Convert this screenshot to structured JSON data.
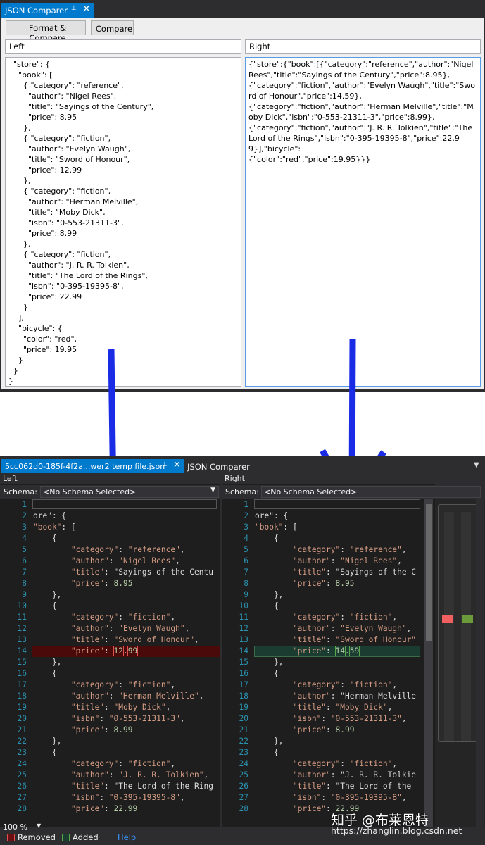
{
  "top_window": {
    "tab_title": "JSON Comparer",
    "tab_pin": "⊥",
    "tab_close": "✕",
    "buttons": {
      "format_compare": "Format & Compare",
      "compare": "Compare"
    },
    "left_header": "Left",
    "right_header": "Right",
    "left_text": "  \"store\": {\n    \"book\": [\n      { \"category\": \"reference\",\n        \"author\": \"Nigel Rees\",\n        \"title\": \"Sayings of the Century\",\n        \"price\": 8.95\n      },\n      { \"category\": \"fiction\",\n        \"author\": \"Evelyn Waugh\",\n        \"title\": \"Sword of Honour\",\n        \"price\": 12.99\n      },\n      { \"category\": \"fiction\",\n        \"author\": \"Herman Melville\",\n        \"title\": \"Moby Dick\",\n        \"isbn\": \"0-553-21311-3\",\n        \"price\": 8.99\n      },\n      { \"category\": \"fiction\",\n        \"author\": \"J. R. R. Tolkien\",\n        \"title\": \"The Lord of the Rings\",\n        \"isbn\": \"0-395-19395-8\",\n        \"price\": 22.99\n      }\n    ],\n    \"bicycle\": {\n      \"color\": \"red\",\n      \"price\": 19.95\n    }\n  }\n}",
    "right_text": "{\"store\":{\"book\":[{\"category\":\"reference\",\"author\":\"Nigel Rees\",\"title\":\"Sayings of the Century\",\"price\":8.95},\n{\"category\":\"fiction\",\"author\":\"Evelyn Waugh\",\"title\":\"Sword of Honour\",\"price\":14.59},\n{\"category\":\"fiction\",\"author\":\"Herman Melville\",\"title\":\"Moby Dick\",\"isbn\":\"0-553-21311-3\",\"price\":8.99},\n{\"category\":\"fiction\",\"author\":\"J. R. R. Tolkien\",\"title\":\"The Lord of the Rings\",\"isbn\":\"0-395-19395-8\",\"price\":22.99}],\"bicycle\":\n{\"color\":\"red\",\"price\":19.95}}}"
  },
  "bottom_window": {
    "tab_active": "5cc062d0-185f-4f2a...wer2 temp file.json",
    "tab_pin": "⊥",
    "tab_close": "✕",
    "tab_other": "JSON Comparer",
    "left_header": "Left",
    "right_header": "Right",
    "schema_label": "Schema:",
    "schema_value": "<No Schema Selected>",
    "left_lines": [
      {
        "n": "1",
        "t": ""
      },
      {
        "n": "2",
        "t": "ore\": {"
      },
      {
        "n": "3",
        "t": "\"book\": ["
      },
      {
        "n": "4",
        "t": "    {"
      },
      {
        "n": "5",
        "t": "        \"category\": \"reference\","
      },
      {
        "n": "6",
        "t": "        \"author\": \"Nigel Rees\","
      },
      {
        "n": "7",
        "t": "        \"title\": \"Sayings of the Centu"
      },
      {
        "n": "8",
        "t": "        \"price\": 8.95"
      },
      {
        "n": "9",
        "t": "    },"
      },
      {
        "n": "10",
        "t": "    {"
      },
      {
        "n": "11",
        "t": "        \"category\": \"fiction\","
      },
      {
        "n": "12",
        "t": "        \"author\": \"Evelyn Waugh\","
      },
      {
        "n": "13",
        "t": "        \"title\": \"Sword of Honour\","
      },
      {
        "n": "14",
        "t": "        \"price\": 12.99"
      },
      {
        "n": "15",
        "t": "    },"
      },
      {
        "n": "16",
        "t": "    {"
      },
      {
        "n": "17",
        "t": "        \"category\": \"fiction\","
      },
      {
        "n": "18",
        "t": "        \"author\": \"Herman Melville\","
      },
      {
        "n": "19",
        "t": "        \"title\": \"Moby Dick\","
      },
      {
        "n": "20",
        "t": "        \"isbn\": \"0-553-21311-3\","
      },
      {
        "n": "21",
        "t": "        \"price\": 8.99"
      },
      {
        "n": "22",
        "t": "    },"
      },
      {
        "n": "23",
        "t": "    {"
      },
      {
        "n": "24",
        "t": "        \"category\": \"fiction\","
      },
      {
        "n": "25",
        "t": "        \"author\": \"J. R. R. Tolkien\","
      },
      {
        "n": "26",
        "t": "        \"title\": \"The Lord of the Ring"
      },
      {
        "n": "27",
        "t": "        \"isbn\": \"0-395-19395-8\","
      },
      {
        "n": "28",
        "t": "        \"price\": 22.99"
      }
    ],
    "right_lines": [
      {
        "n": "1",
        "t": ""
      },
      {
        "n": "2",
        "t": "ore\": {"
      },
      {
        "n": "3",
        "t": "\"book\": ["
      },
      {
        "n": "4",
        "t": "    {"
      },
      {
        "n": "5",
        "t": "        \"category\": \"reference\","
      },
      {
        "n": "6",
        "t": "        \"author\": \"Nigel Rees\","
      },
      {
        "n": "7",
        "t": "        \"title\": \"Sayings of the C"
      },
      {
        "n": "8",
        "t": "        \"price\": 8.95"
      },
      {
        "n": "9",
        "t": "    },"
      },
      {
        "n": "10",
        "t": "    {"
      },
      {
        "n": "11",
        "t": "        \"category\": \"fiction\","
      },
      {
        "n": "12",
        "t": "        \"author\": \"Evelyn Waugh\","
      },
      {
        "n": "13",
        "t": "        \"title\": \"Sword of Honour\""
      },
      {
        "n": "14",
        "t": "        \"price\": 14.59"
      },
      {
        "n": "15",
        "t": "    },"
      },
      {
        "n": "16",
        "t": "    {"
      },
      {
        "n": "17",
        "t": "        \"category\": \"fiction\","
      },
      {
        "n": "18",
        "t": "        \"author\": \"Herman Melville"
      },
      {
        "n": "19",
        "t": "        \"title\": \"Moby Dick\","
      },
      {
        "n": "20",
        "t": "        \"isbn\": \"0-553-21311-3\","
      },
      {
        "n": "21",
        "t": "        \"price\": 8.99"
      },
      {
        "n": "22",
        "t": "    },"
      },
      {
        "n": "23",
        "t": "    {"
      },
      {
        "n": "24",
        "t": "        \"category\": \"fiction\","
      },
      {
        "n": "25",
        "t": "        \"author\": \"J. R. R. Tolkie"
      },
      {
        "n": "26",
        "t": "        \"title\": \"The Lord of the "
      },
      {
        "n": "27",
        "t": "        \"isbn\": \"0-395-19395-8\","
      },
      {
        "n": "28",
        "t": "        \"price\": 22.99"
      }
    ],
    "removed_line": "14",
    "added_line": "14",
    "removed_value": "12.99",
    "added_value": "14.59",
    "zoom": "100 %",
    "legend_removed": "Removed",
    "legend_added": "Added",
    "help": "Help",
    "colors": {
      "removed": "#e05050",
      "added": "#57a64a",
      "accent": "#007acc"
    }
  },
  "watermark": {
    "text": "知乎 @布莱恩特",
    "url": "https://zhanglin.blog.csdn.net"
  }
}
